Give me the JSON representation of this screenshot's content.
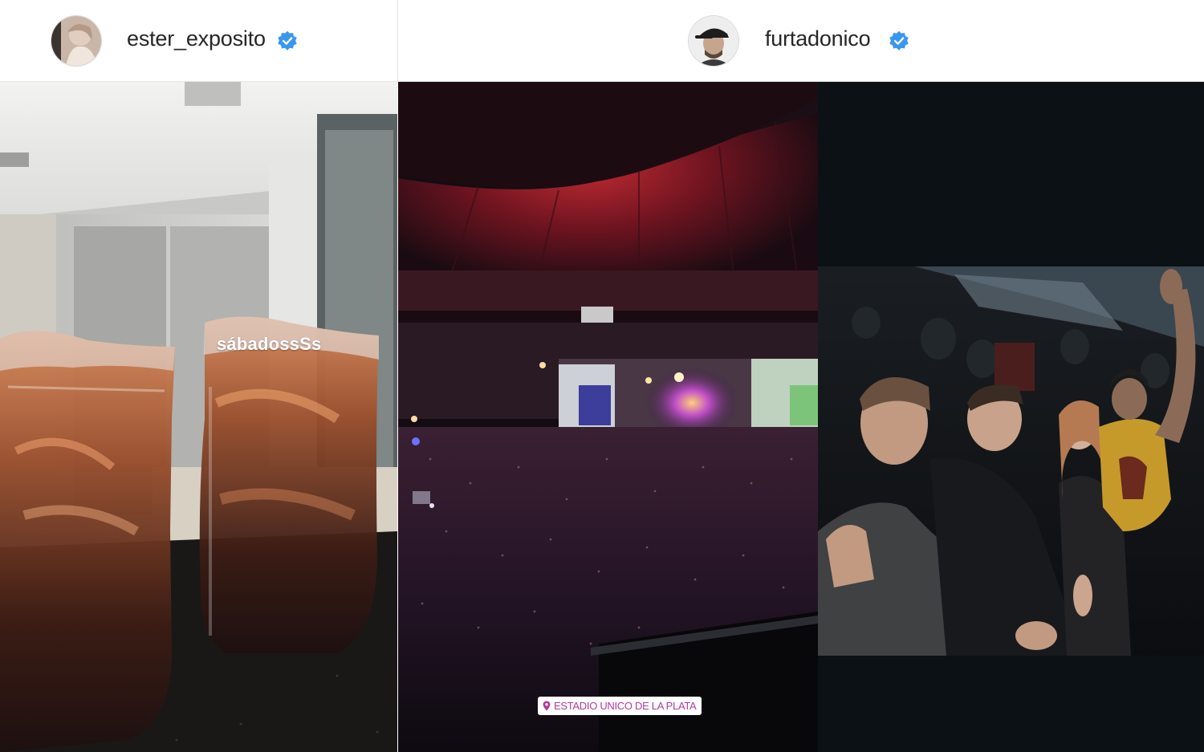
{
  "stories": [
    {
      "username": "ester_exposito",
      "verified": true,
      "caption": "sábadossSs"
    },
    {
      "username": "furtadonico",
      "verified": true,
      "location_sticker": "ESTADIO UNICO DE LA PLATA"
    }
  ],
  "colors": {
    "verified_badge": "#3897f0",
    "username_text": "#262626",
    "location_text": "#b13a9b"
  },
  "icons": [
    "verified-badge-icon",
    "location-pin-icon"
  ]
}
